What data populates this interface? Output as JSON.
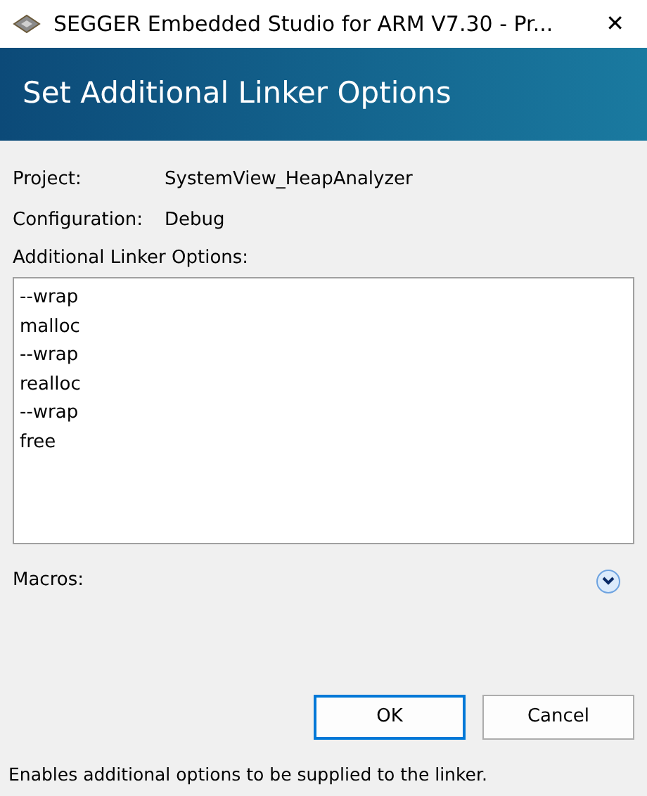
{
  "window": {
    "title": "SEGGER Embedded Studio for ARM V7.30 - Pr...",
    "close": "✕"
  },
  "banner": {
    "title": "Set Additional Linker Options"
  },
  "fields": [
    {
      "label": "Project:",
      "value": "SystemView_HeapAnalyzer"
    },
    {
      "label": "Configuration:",
      "value": "Debug"
    }
  ],
  "options": {
    "label": "Additional Linker Options:",
    "lines": [
      "--wrap",
      "malloc",
      "--wrap",
      "realloc",
      "--wrap",
      "free"
    ]
  },
  "macros": {
    "label": "Macros:",
    "expanded": false
  },
  "buttons": [
    {
      "label": "OK",
      "default": true
    },
    {
      "label": "Cancel",
      "default": false
    }
  ],
  "status_bar": "Enables additional options to be supplied to the linker."
}
